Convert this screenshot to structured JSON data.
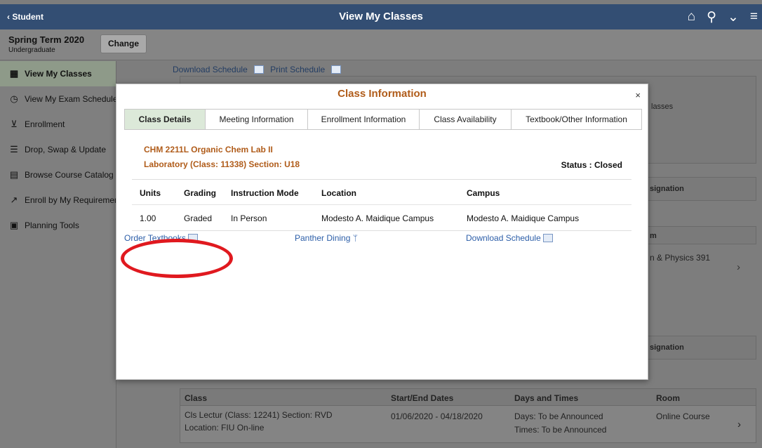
{
  "header": {
    "back_label": "Student",
    "title": "View My Classes"
  },
  "term": {
    "name": "Spring Term 2020",
    "career": "Undergraduate",
    "change_label": "Change"
  },
  "sidebar": {
    "items": [
      {
        "label": "View My Classes",
        "icon": "calendar-icon",
        "active": true
      },
      {
        "label": "View My Exam Schedule",
        "icon": "clock-calendar-icon",
        "active": false
      },
      {
        "label": "Enrollment",
        "icon": "cart-icon",
        "active": false
      },
      {
        "label": "Drop, Swap & Update",
        "icon": "list-edit-icon",
        "active": false
      },
      {
        "label": "Browse Course Catalog",
        "icon": "catalog-icon",
        "active": false
      },
      {
        "label": "Enroll by My Requirements",
        "icon": "chart-line-icon",
        "active": false
      },
      {
        "label": "Planning Tools",
        "icon": "planner-icon",
        "active": false
      }
    ]
  },
  "background": {
    "download_schedule": "Download Schedule",
    "print_schedule": "Print Schedule",
    "classes_fragment": "lasses",
    "designation_fragment_1": "signation",
    "room_fragment": "m",
    "room_value_fragment": "n & Physics 391",
    "designation_fragment_2": "signation",
    "table": {
      "headers": [
        "Class",
        "Start/End Dates",
        "Days and Times",
        "Room"
      ],
      "row": {
        "class_line1": "Cls Lectur (Class: 12241) Section: RVD",
        "class_line2": "Location: FIU On-line",
        "dates": "01/06/2020 - 04/18/2020",
        "days": "Days: To be Announced",
        "times": "Times: To be Announced",
        "room": "Online Course"
      }
    }
  },
  "modal": {
    "title": "Class Information",
    "close_symbol": "×",
    "tabs": [
      {
        "label": "Class Details",
        "active": true
      },
      {
        "label": "Meeting Information",
        "active": false
      },
      {
        "label": "Enrollment Information",
        "active": false
      },
      {
        "label": "Class Availability",
        "active": false
      },
      {
        "label": "Textbook/Other Information",
        "active": false
      }
    ],
    "course_title": "CHM 2211L Organic Chem Lab II",
    "course_subtitle": "Laboratory (Class: 11338) Section: U18",
    "status": "Status : Closed",
    "table": {
      "headers": [
        "Units",
        "Grading",
        "Instruction Mode",
        "Location",
        "Campus"
      ],
      "row": [
        "1.00",
        "Graded",
        "In Person",
        "Modesto A. Maidique Campus",
        "Modesto A. Maidique Campus"
      ]
    },
    "links": {
      "order_textbooks": "Order Textbooks",
      "panther_dining": "Panther Dining",
      "download_schedule": "Download Schedule"
    }
  },
  "colors": {
    "header_bg": "#334e73",
    "accent_orange": "#b05c1a",
    "link_blue": "#2c5ea8",
    "active_tab_bg": "#dce9d9",
    "annotation_red": "#e0191f"
  }
}
